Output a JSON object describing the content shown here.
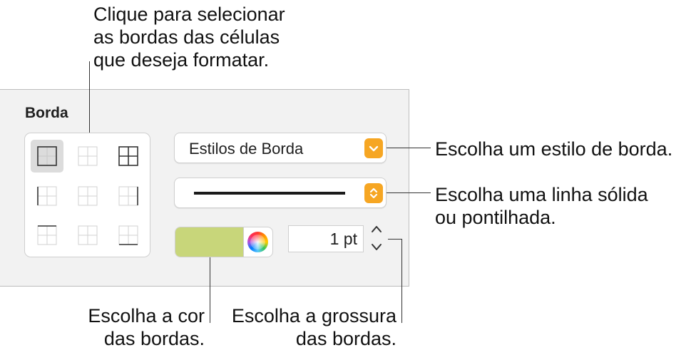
{
  "callouts": {
    "select_borders": "Clique para selecionar\nas bordas das células\nque deseja formatar.",
    "border_style": "Escolha um estilo de borda.",
    "line_style": "Escolha uma linha sólida\nou pontilhada.",
    "border_color": "Escolha a cor\ndas bordas.",
    "border_thickness": "Escolha a grossura\ndas bordas."
  },
  "panel": {
    "title": "Borda",
    "border_cells": [
      {
        "id": "outer",
        "selected": true
      },
      {
        "id": "inner"
      },
      {
        "id": "all"
      },
      {
        "id": "left"
      },
      {
        "id": "inner-vertical"
      },
      {
        "id": "right"
      },
      {
        "id": "top"
      },
      {
        "id": "inner-horizontal"
      },
      {
        "id": "bottom"
      }
    ],
    "style_popup": {
      "label": "Estilos de Borda",
      "icon": "chevron-down-icon"
    },
    "line_popup": {
      "value": "solid",
      "icon": "up-down-chevron-icon"
    },
    "color": {
      "fill": "#c8d67a",
      "icon": "color-wheel-icon"
    },
    "thickness": {
      "value": "1 pt",
      "icon": "stepper-icon"
    }
  },
  "colors": {
    "accent": "#f6a623",
    "panel_bg": "#f2f2f2"
  }
}
